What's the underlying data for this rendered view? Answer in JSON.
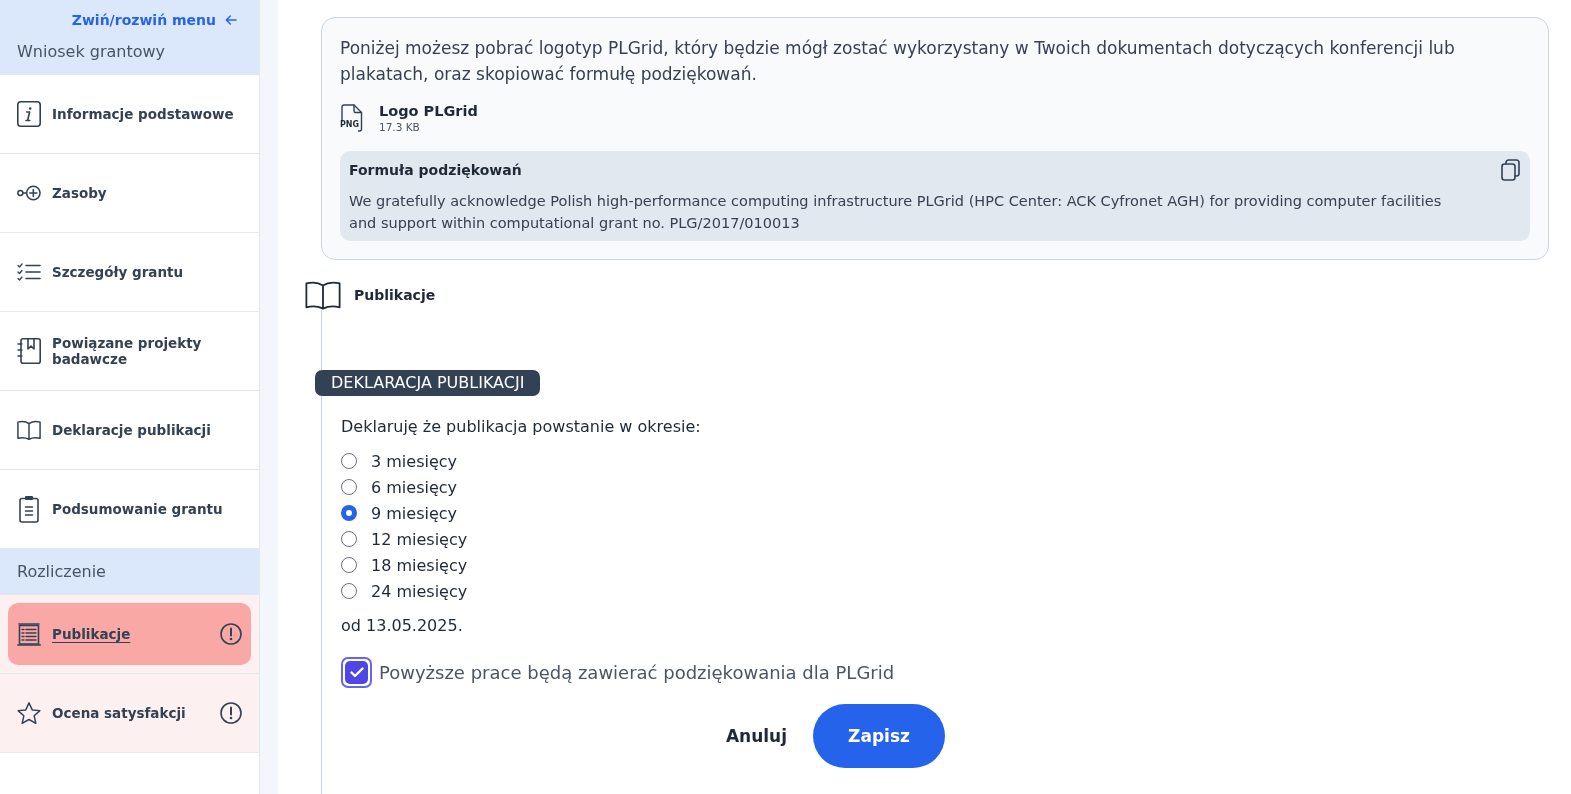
{
  "sidebar": {
    "toggle": {
      "label": "Zwiń/rozwiń menu"
    },
    "sections": [
      {
        "title": "Wniosek grantowy",
        "items": [
          {
            "label": "Informacje podstawowe",
            "selected": false,
            "alert": false
          },
          {
            "label": "Zasoby",
            "selected": false,
            "alert": false
          },
          {
            "label": "Szczegóły grantu",
            "selected": false,
            "alert": false
          },
          {
            "label": "Powiązane projekty badawcze",
            "selected": false,
            "alert": false
          },
          {
            "label": "Deklaracje publikacji",
            "selected": false,
            "alert": false
          },
          {
            "label": "Podsumowanie grantu",
            "selected": false,
            "alert": false
          }
        ]
      },
      {
        "title": "Rozliczenie",
        "items": [
          {
            "label": "Publikacje",
            "selected": true,
            "alert": true
          },
          {
            "label": "Ocena satysfakcji",
            "selected": false,
            "alert": true
          }
        ]
      }
    ]
  },
  "info_card": {
    "text": "Poniżej możesz pobrać logotyp PLGrid, który będzie mógł zostać wykorzystany w Twoich dokumentach dotyczących konferencji lub plakatach, oraz skopiować formułę podziękowań.",
    "file": {
      "format": "PNG",
      "name": "Logo PLGrid",
      "size": "17.3 KB"
    },
    "acknowledgement": {
      "title": "Formuła podziękowań",
      "text": "We gratefully acknowledge Polish high-performance computing infrastructure PLGrid (HPC Center: ACK Cyfronet AGH) for providing computer facilities and support within computational grant no. PLG/2017/010013"
    }
  },
  "section": {
    "title": "Publikacje"
  },
  "declaration": {
    "badge": "DEKLARACJA PUBLIKACJI",
    "prompt": "Deklaruję że publikacja powstanie w okresie:",
    "options": [
      {
        "label": "3 miesięcy",
        "selected": false
      },
      {
        "label": "6 miesięcy",
        "selected": false
      },
      {
        "label": "9 miesięcy",
        "selected": true
      },
      {
        "label": "12 miesięcy",
        "selected": false
      },
      {
        "label": "18 miesięcy",
        "selected": false
      },
      {
        "label": "24 miesięcy",
        "selected": false
      }
    ],
    "start_date": "od 13.05.2025.",
    "acknowledgement_checkbox": {
      "label": "Powyższe prace będą zawierać podziękowania dla PLGrid",
      "checked": true
    }
  },
  "actions": {
    "cancel": "Anuluj",
    "save": "Zapisz"
  }
}
